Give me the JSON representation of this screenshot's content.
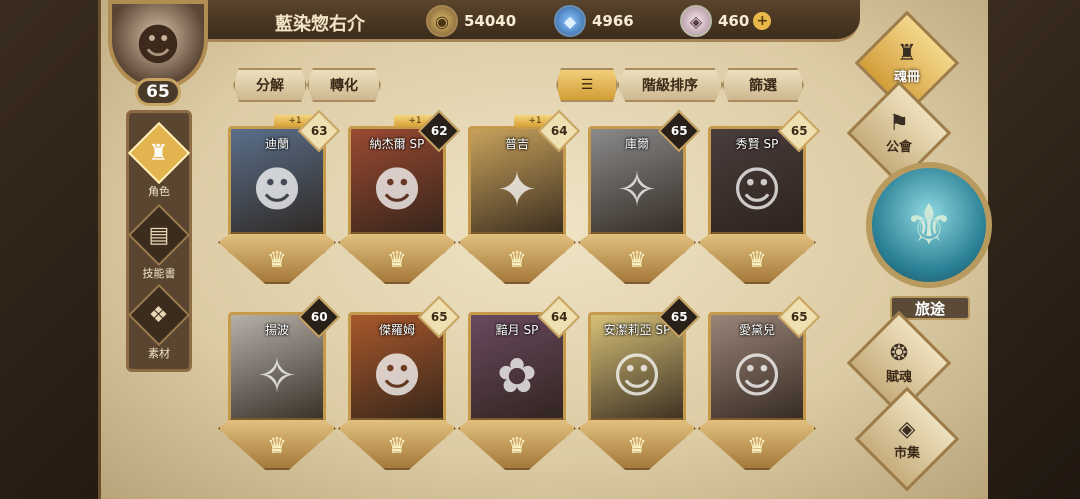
{
  "player": {
    "name": "藍染惣右介",
    "level": "65"
  },
  "currencies": {
    "gold": "54040",
    "crystal": "4966",
    "gem": "460",
    "gem_plus": "+"
  },
  "side_nav": {
    "items": [
      {
        "label": "角色",
        "icon": "helmet-icon"
      },
      {
        "label": "技能書",
        "icon": "book-icon"
      },
      {
        "label": "素材",
        "icon": "material-icon"
      }
    ]
  },
  "toolbar": {
    "decompose": "分解",
    "transform": "轉化",
    "sort_order": "階級排序",
    "filter": "篩選"
  },
  "cards": [
    {
      "name": "迪蘭",
      "level": "63",
      "plus": "+1",
      "level_style": "gold",
      "art_color": "#5a6f8a",
      "art_icon": "☻"
    },
    {
      "name": "納杰爾 SP",
      "level": "62",
      "plus": "+1",
      "level_style": "dark",
      "art_color": "#9a4a32",
      "art_icon": "☻"
    },
    {
      "name": "普吉",
      "level": "64",
      "plus": "+1",
      "level_style": "light",
      "art_color": "#c8a25c",
      "art_icon": "✦"
    },
    {
      "name": "庫爾",
      "level": "65",
      "plus": "",
      "level_style": "dark",
      "art_color": "#8a8a8a",
      "art_icon": "✧"
    },
    {
      "name": "秀賢 SP",
      "level": "65",
      "plus": "",
      "level_style": "gold",
      "art_color": "#4a3d3d",
      "art_icon": "☺"
    },
    {
      "name": "揚波",
      "level": "60",
      "plus": "",
      "level_style": "dark",
      "art_color": "#b5b0a8",
      "art_icon": "✧"
    },
    {
      "name": "傑羅姆",
      "level": "65",
      "plus": "",
      "level_style": "gold",
      "art_color": "#a8582c",
      "art_icon": "☻"
    },
    {
      "name": "黯月 SP",
      "level": "64",
      "plus": "",
      "level_style": "light",
      "art_color": "#6a4a60",
      "art_icon": "✿"
    },
    {
      "name": "安潔莉亞 SP",
      "level": "65",
      "plus": "",
      "level_style": "dark",
      "art_color": "#d6c078",
      "art_icon": "☺"
    },
    {
      "name": "愛黛兒",
      "level": "65",
      "plus": "",
      "level_style": "light",
      "art_color": "#9a8478",
      "art_icon": "☺"
    }
  ],
  "right_nav": {
    "soulbook": "魂冊",
    "guild": "公會",
    "journey": "旅途",
    "talent": "賦魂",
    "market": "市集"
  }
}
